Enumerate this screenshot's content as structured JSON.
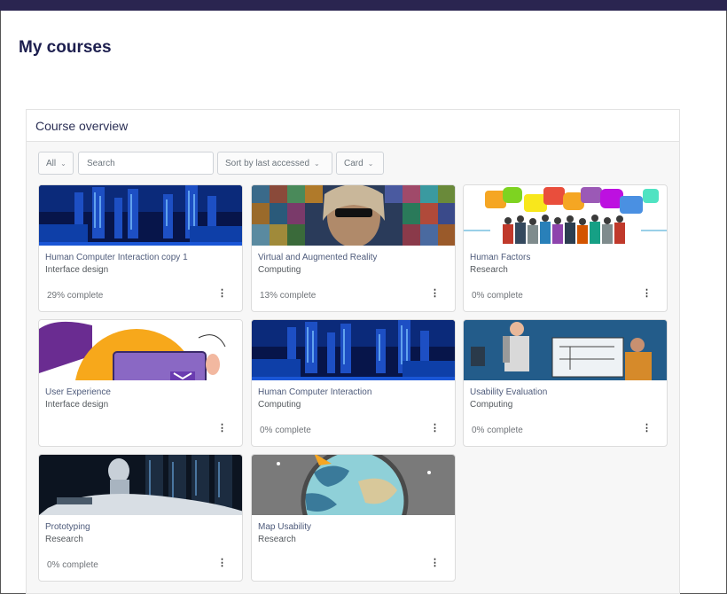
{
  "page": {
    "title": "My courses"
  },
  "course_overview": {
    "heading": "Course overview",
    "filter_all": "All",
    "search_placeholder": "Search",
    "sort_label": "Sort by last accessed",
    "view_label": "Card"
  },
  "courses": [
    {
      "name": "Human Computer Interaction copy 1",
      "category": "Interface design",
      "progress": "29% complete",
      "progress_value": 29,
      "image": "city-servers"
    },
    {
      "name": "Virtual and Augmented Reality",
      "category": "Computing",
      "progress": "13% complete",
      "progress_value": 13,
      "image": "vr-mosaic"
    },
    {
      "name": "Human Factors",
      "category": "Research",
      "progress": "0% complete",
      "progress_value": 0,
      "image": "crowd-speech-bubbles"
    },
    {
      "name": "User Experience",
      "category": "Interface design",
      "progress": "",
      "image": "ux-illustration"
    },
    {
      "name": "Human Computer Interaction",
      "category": "Computing",
      "progress": "0% complete",
      "progress_value": 0,
      "image": "city-servers"
    },
    {
      "name": "Usability Evaluation",
      "category": "Computing",
      "progress": "0% complete",
      "progress_value": 0,
      "image": "engineers-illustration"
    },
    {
      "name": "Prototyping",
      "category": "Research",
      "progress": "0% complete",
      "progress_value": 0,
      "image": "datacenter-car"
    },
    {
      "name": "Map Usability",
      "category": "Research",
      "progress": "",
      "image": "globe"
    }
  ],
  "icons": {
    "card_menu": "vertical-ellipsis-icon",
    "dropdown": "chevron-down-icon"
  },
  "colors": {
    "topbar": "#2a2550",
    "title": "#1d1f4f",
    "course_name": "#4d5a7a"
  },
  "menu_glyph": "⋮",
  "chevron_glyph": "⌄"
}
